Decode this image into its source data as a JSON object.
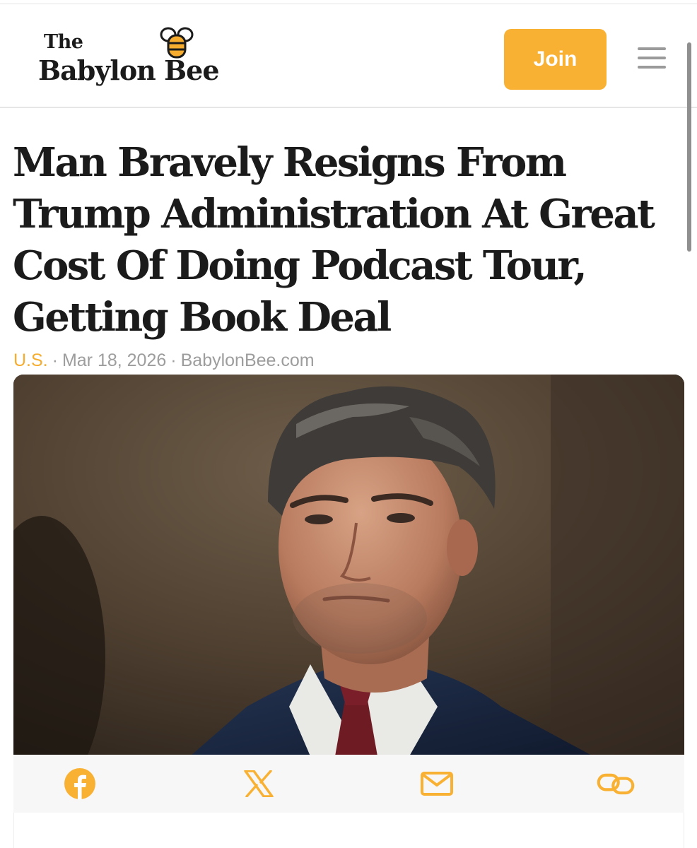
{
  "header": {
    "logo_small": "The",
    "logo_main": "Babylon Bee",
    "join_label": "Join"
  },
  "article": {
    "headline": "Man Bravely Resigns From Trump Administration At Great Cost Of Doing Podcast Tour, Getting Book Deal",
    "meta": {
      "category": "U.S.",
      "separator": "·",
      "date": "Mar 18, 2026",
      "source": "BabylonBee.com"
    }
  },
  "share": {
    "buttons": [
      "facebook-icon",
      "x-icon",
      "email-icon",
      "link-icon"
    ]
  },
  "colors": {
    "accent": "#f9b134",
    "text": "#1b1b1b",
    "meta": "#9d9d9d"
  }
}
